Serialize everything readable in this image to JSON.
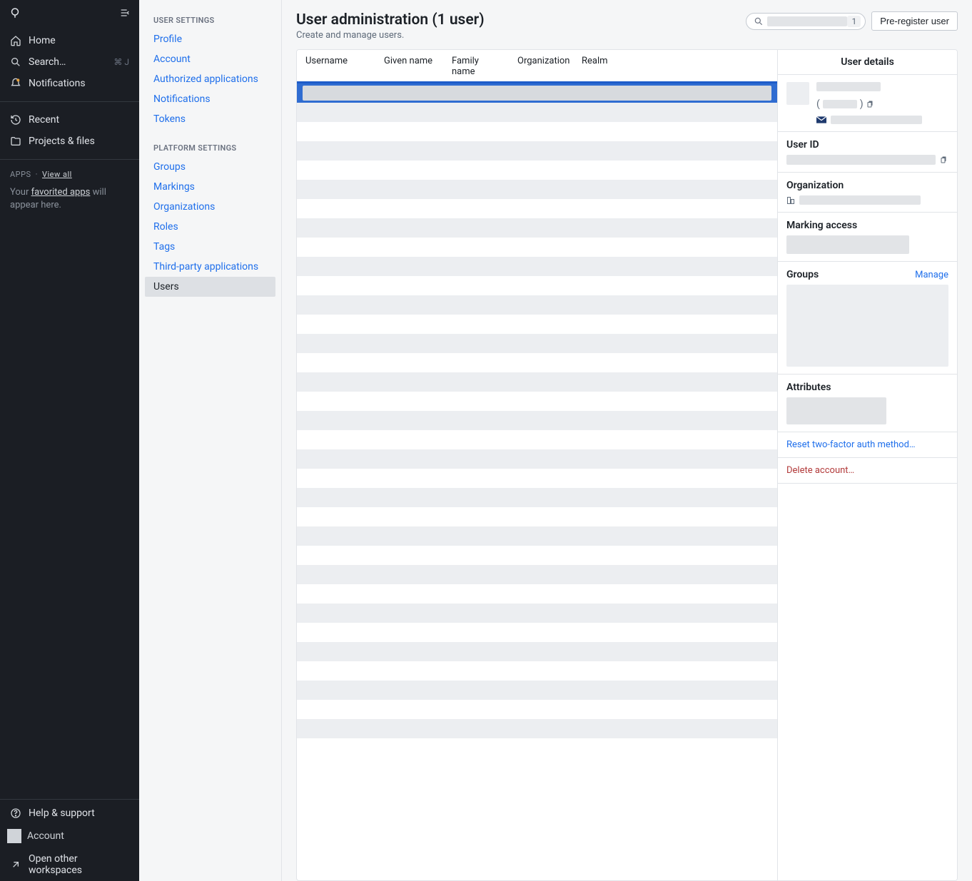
{
  "sidebar": {
    "home": "Home",
    "search": "Search…",
    "search_kbd": "⌘ J",
    "notifications": "Notifications",
    "recent": "Recent",
    "projects": "Projects & files",
    "apps_label": "APPS",
    "view_all": "View all",
    "fav_prefix": "Your ",
    "fav_link": "favorited apps",
    "fav_suffix": " will appear here.",
    "help": "Help & support",
    "account": "Account",
    "open_workspaces": "Open other workspaces"
  },
  "settings": {
    "user_settings_label": "USER SETTINGS",
    "user_items": [
      "Profile",
      "Account",
      "Authorized applications",
      "Notifications",
      "Tokens"
    ],
    "platform_settings_label": "PLATFORM SETTINGS",
    "platform_items": [
      "Groups",
      "Markings",
      "Organizations",
      "Roles",
      "Tags",
      "Third-party applications",
      "Users"
    ],
    "active_item": "Users"
  },
  "main": {
    "title": "User administration (1 user)",
    "subtitle": "Create and manage users.",
    "search_placeholder": "",
    "search_count": "1",
    "preregister": "Pre-register user"
  },
  "table": {
    "columns": [
      "Username",
      "Given name",
      "Family name",
      "Organization",
      "Realm"
    ]
  },
  "details": {
    "header": "User details",
    "user_id_label": "User ID",
    "organization_label": "Organization",
    "marking_label": "Marking access",
    "groups_label": "Groups",
    "manage": "Manage",
    "attributes_label": "Attributes",
    "reset_2fa": "Reset two-factor auth method…",
    "delete_account": "Delete account…"
  }
}
